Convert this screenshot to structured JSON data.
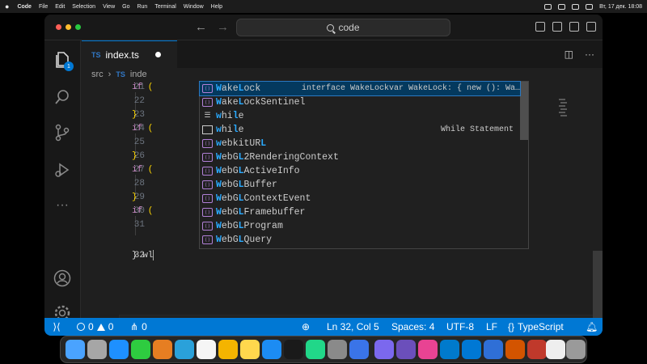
{
  "menubar": {
    "app": "Code",
    "items": [
      "File",
      "Edit",
      "Selection",
      "View",
      "Go",
      "Run",
      "Terminal",
      "Window",
      "Help"
    ],
    "clock": "Вт, 17 дек. 18:08"
  },
  "titlebar": {
    "command_center": "code"
  },
  "activity": {
    "explorer_badge": "1"
  },
  "tab": {
    "lang": "TS",
    "filename": "index.ts"
  },
  "breadcrumb": {
    "folder": "src",
    "lang": "TS",
    "file": "inde"
  },
  "code_lines": [
    {
      "num": "21",
      "kw": "if",
      "rest": " ("
    },
    {
      "num": "22",
      "kw": "",
      "rest": ""
    },
    {
      "num": "23",
      "kw": "",
      "rest": "}"
    },
    {
      "num": "24",
      "kw": "if",
      "rest": " ("
    },
    {
      "num": "25",
      "kw": "",
      "rest": ""
    },
    {
      "num": "26",
      "kw": "",
      "rest": "}"
    },
    {
      "num": "27",
      "kw": "if",
      "rest": " ("
    },
    {
      "num": "28",
      "kw": "",
      "rest": ""
    },
    {
      "num": "29",
      "kw": "",
      "rest": "}"
    },
    {
      "num": "30",
      "kw": "if",
      "rest": " ("
    },
    {
      "num": "31",
      "kw": "",
      "rest": ""
    },
    {
      "num": "32",
      "kw": "",
      "rest": "} wl"
    }
  ],
  "suggest": {
    "items": [
      {
        "icon": "interface",
        "hl": "W",
        "mid": "ake",
        "hl2": "L",
        "tail": "ock",
        "detail": "interface WakeLockvar WakeLock: { new (): Wa…",
        "selected": true
      },
      {
        "icon": "interface",
        "hl": "W",
        "mid": "ake",
        "hl2": "L",
        "tail": "ockSentinel",
        "detail": "",
        "selected": false
      },
      {
        "icon": "keyword",
        "hl": "w",
        "mid": "hi",
        "hl2": "l",
        "tail": "e",
        "detail": "",
        "selected": false
      },
      {
        "icon": "snippet",
        "hl": "w",
        "mid": "hi",
        "hl2": "l",
        "tail": "e",
        "detail": "While Statement",
        "selected": false
      },
      {
        "icon": "interface",
        "hl": "w",
        "mid": "ebkitUR",
        "hl2": "L",
        "tail": "",
        "detail": "",
        "selected": false
      },
      {
        "icon": "interface",
        "hl": "W",
        "mid": "ebG",
        "hl2": "L",
        "tail": "2RenderingContext",
        "detail": "",
        "selected": false
      },
      {
        "icon": "interface",
        "hl": "W",
        "mid": "ebG",
        "hl2": "L",
        "tail": "ActiveInfo",
        "detail": "",
        "selected": false
      },
      {
        "icon": "interface",
        "hl": "W",
        "mid": "ebG",
        "hl2": "L",
        "tail": "Buffer",
        "detail": "",
        "selected": false
      },
      {
        "icon": "interface",
        "hl": "W",
        "mid": "ebG",
        "hl2": "L",
        "tail": "ContextEvent",
        "detail": "",
        "selected": false
      },
      {
        "icon": "interface",
        "hl": "W",
        "mid": "ebG",
        "hl2": "L",
        "tail": "Framebuffer",
        "detail": "",
        "selected": false
      },
      {
        "icon": "interface",
        "hl": "W",
        "mid": "ebG",
        "hl2": "L",
        "tail": "Program",
        "detail": "",
        "selected": false
      },
      {
        "icon": "interface",
        "hl": "W",
        "mid": "ebG",
        "hl2": "L",
        "tail": "Query",
        "detail": "",
        "selected": false
      }
    ]
  },
  "status": {
    "errors": "0",
    "warnings": "0",
    "ports": "0",
    "position": "Ln 32, Col 5",
    "spaces": "Spaces: 4",
    "encoding": "UTF-8",
    "eol": "LF",
    "language": "TypeScript"
  },
  "colors": {
    "accent": "#0078d4",
    "editor_bg": "#1f1f1f",
    "match_highlight": "#2aaaff"
  }
}
